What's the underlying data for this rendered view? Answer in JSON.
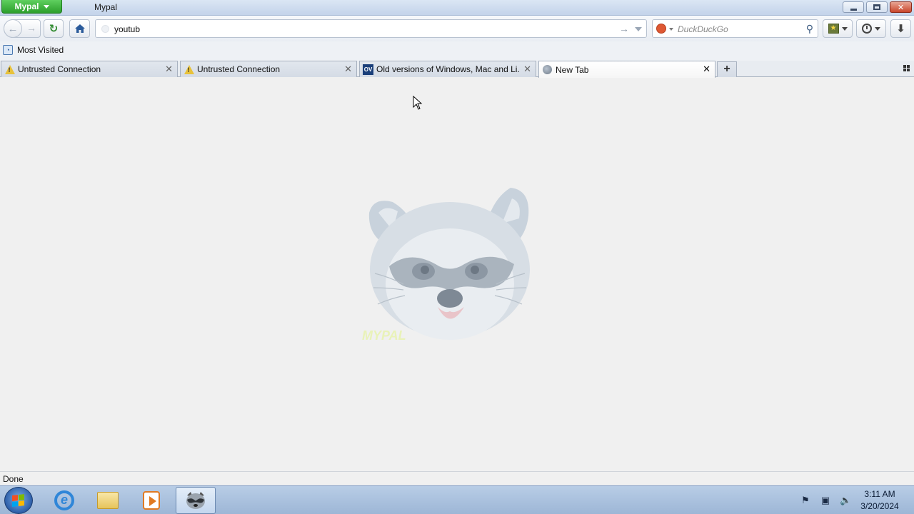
{
  "window": {
    "app_menu_label": "Mypal",
    "title": "Mypal"
  },
  "navbar": {
    "url_value": "youtub",
    "search_placeholder": "DuckDuckGo",
    "search_engine": "DuckDuckGo"
  },
  "bookmarks": {
    "items": [
      {
        "label": "Most Visited"
      }
    ]
  },
  "tabs": [
    {
      "title": "Untrusted Connection",
      "icon": "warning-icon",
      "active": false
    },
    {
      "title": "Untrusted Connection",
      "icon": "warning-icon",
      "active": false
    },
    {
      "title": "Old versions of Windows, Mac and Li...",
      "icon": "oldversion-icon",
      "active": false
    },
    {
      "title": "New Tab",
      "icon": "globe-icon",
      "active": true
    }
  ],
  "content": {
    "watermark_label": "MYPAL"
  },
  "status": {
    "text": "Done"
  },
  "taskbar": {
    "apps": [
      "internet-explorer",
      "file-explorer",
      "media-player",
      "mypal-browser"
    ],
    "clock_time": "3:11 AM",
    "clock_date": "3/20/2024"
  },
  "colors": {
    "app_menu": "#2c9f2c",
    "titlebar": "#c3d3ea",
    "taskbar": "#9db6d6",
    "content_bg": "#f0f0f0"
  }
}
